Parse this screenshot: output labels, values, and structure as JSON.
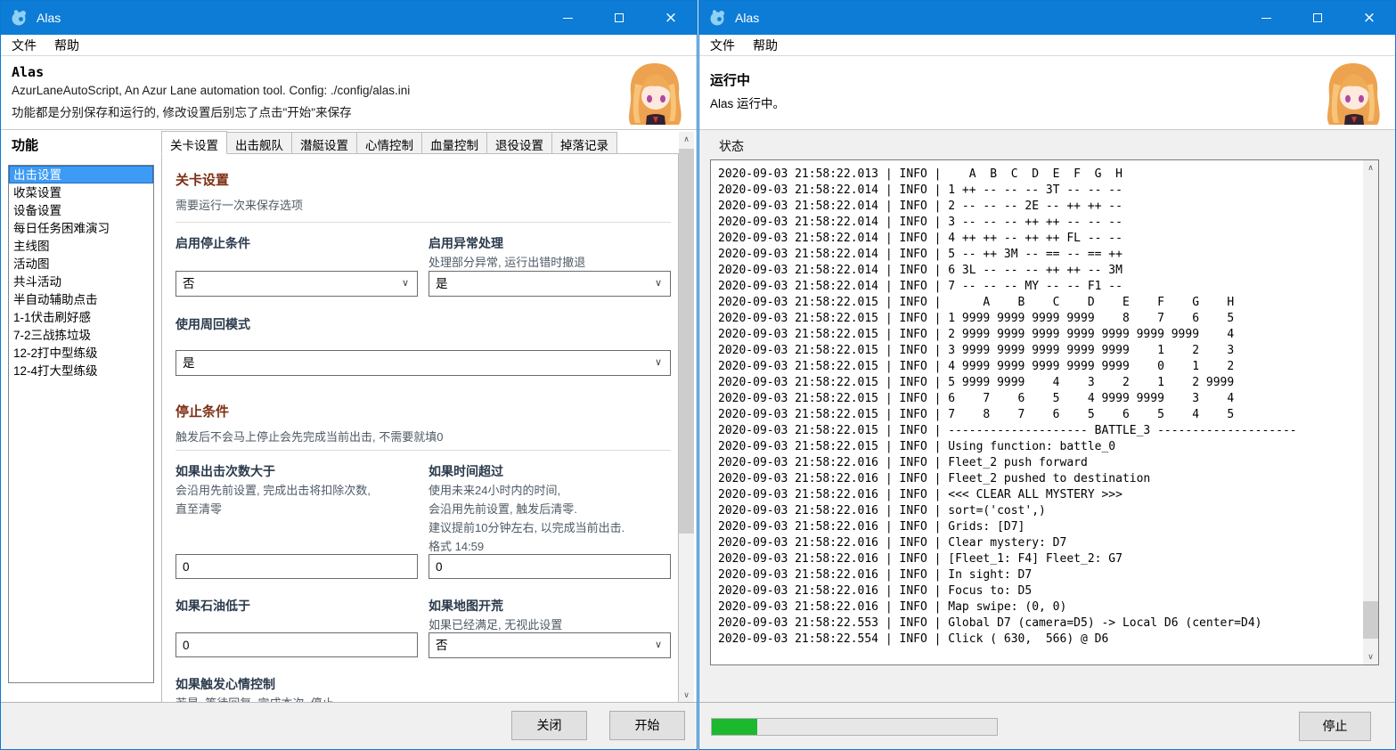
{
  "icons": {
    "close_glyph": "×",
    "chevron_down": "∨",
    "scroll_up": "∧",
    "scroll_down": "∨"
  },
  "colors": {
    "titlebar_blue": "#0c7cd6",
    "selection_blue": "#3d9bf5",
    "section_maroon": "#7e2f15",
    "progress_green": "#1cb82d"
  },
  "titlebar": {
    "title": "Alas"
  },
  "menubar": {
    "file": "文件",
    "help": "帮助"
  },
  "left": {
    "header": {
      "title": "Alas",
      "line1": "AzurLaneAutoScript, An Azur Lane automation tool. Config: ./config/alas.ini",
      "line2": "功能都是分别保存和运行的, 修改设置后别忘了点击\"开始\"来保存"
    },
    "sidebar": {
      "heading": "功能",
      "items": [
        {
          "label": "出击设置",
          "selected": true
        },
        {
          "label": "收菜设置",
          "selected": false
        },
        {
          "label": "设备设置",
          "selected": false
        },
        {
          "label": "每日任务困难演习",
          "selected": false
        },
        {
          "label": "主线图",
          "selected": false
        },
        {
          "label": "活动图",
          "selected": false
        },
        {
          "label": "共斗活动",
          "selected": false
        },
        {
          "label": "半自动辅助点击",
          "selected": false
        },
        {
          "label": "1-1伏击刷好感",
          "selected": false
        },
        {
          "label": "7-2三战拣垃圾",
          "selected": false
        },
        {
          "label": "12-2打中型练级",
          "selected": false
        },
        {
          "label": "12-4打大型练级",
          "selected": false
        }
      ]
    },
    "tabs": [
      {
        "label": "关卡设置",
        "active": true
      },
      {
        "label": "出击舰队",
        "active": false
      },
      {
        "label": "潜艇设置",
        "active": false
      },
      {
        "label": "心情控制",
        "active": false
      },
      {
        "label": "血量控制",
        "active": false
      },
      {
        "label": "退役设置",
        "active": false
      },
      {
        "label": "掉落记录",
        "active": false
      }
    ],
    "form": {
      "section1": {
        "title": "关卡设置",
        "subtitle": "需要运行一次来保存选项"
      },
      "enable_stop": {
        "label": "启用停止条件",
        "value": "否"
      },
      "enable_exception": {
        "label": "启用异常处理",
        "desc": "处理部分异常, 运行出错时撤退",
        "value": "是"
      },
      "loop_mode": {
        "label": "使用周回模式",
        "value": "是"
      },
      "section2": {
        "title": "停止条件",
        "subtitle": "触发后不会马上停止会先完成当前出击, 不需要就填0"
      },
      "if_count": {
        "label": "如果出击次数大于",
        "desc1": "会沿用先前设置, 完成出击将扣除次数,",
        "desc2": "直至清零",
        "value": "0"
      },
      "if_time": {
        "label": "如果时间超过",
        "desc1": "使用未来24小时内的时间,",
        "desc2": "会沿用先前设置, 触发后清零.",
        "desc3": "建议提前10分钟左右, 以完成当前出击.",
        "desc4": "格式 14:59",
        "value": "0"
      },
      "if_oil": {
        "label": "如果石油低于",
        "value": "0"
      },
      "if_map_clear": {
        "label": "如果地图开荒",
        "desc": "如果已经满足, 无视此设置",
        "value": "否"
      },
      "if_emotion": {
        "label": "如果触发心情控制",
        "desc": "若是, 等待回复, 完成本次, 停止"
      }
    },
    "footer": {
      "close": "关闭",
      "start": "开始"
    }
  },
  "right": {
    "header": {
      "title": "运行中",
      "line1": "Alas 运行中。"
    },
    "status_label": "状态",
    "log_lines": [
      "2020-09-03 21:58:22.013 | INFO |    A  B  C  D  E  F  G  H",
      "2020-09-03 21:58:22.014 | INFO | 1 ++ -- -- -- 3T -- -- --",
      "2020-09-03 21:58:22.014 | INFO | 2 -- -- -- 2E -- ++ ++ --",
      "2020-09-03 21:58:22.014 | INFO | 3 -- -- -- ++ ++ -- -- --",
      "2020-09-03 21:58:22.014 | INFO | 4 ++ ++ -- ++ ++ FL -- --",
      "2020-09-03 21:58:22.014 | INFO | 5 -- ++ 3M -- == -- == ++",
      "2020-09-03 21:58:22.014 | INFO | 6 3L -- -- -- ++ ++ -- 3M",
      "2020-09-03 21:58:22.014 | INFO | 7 -- -- -- MY -- -- F1 --",
      "2020-09-03 21:58:22.015 | INFO |      A    B    C    D    E    F    G    H",
      "2020-09-03 21:58:22.015 | INFO | 1 9999 9999 9999 9999    8    7    6    5",
      "2020-09-03 21:58:22.015 | INFO | 2 9999 9999 9999 9999 9999 9999 9999    4",
      "2020-09-03 21:58:22.015 | INFO | 3 9999 9999 9999 9999 9999    1    2    3",
      "2020-09-03 21:58:22.015 | INFO | 4 9999 9999 9999 9999 9999    0    1    2",
      "2020-09-03 21:58:22.015 | INFO | 5 9999 9999    4    3    2    1    2 9999",
      "2020-09-03 21:58:22.015 | INFO | 6    7    6    5    4 9999 9999    3    4",
      "2020-09-03 21:58:22.015 | INFO | 7    8    7    6    5    6    5    4    5",
      "2020-09-03 21:58:22.015 | INFO | -------------------- BATTLE_3 --------------------",
      "2020-09-03 21:58:22.015 | INFO | Using function: battle_0",
      "2020-09-03 21:58:22.016 | INFO | Fleet_2 push forward",
      "2020-09-03 21:58:22.016 | INFO | Fleet_2 pushed to destination",
      "2020-09-03 21:58:22.016 | INFO | <<< CLEAR ALL MYSTERY >>>",
      "2020-09-03 21:58:22.016 | INFO | sort=('cost',)",
      "2020-09-03 21:58:22.016 | INFO | Grids: [D7]",
      "2020-09-03 21:58:22.016 | INFO | Clear mystery: D7",
      "2020-09-03 21:58:22.016 | INFO | [Fleet_1: F4] Fleet_2: G7",
      "2020-09-03 21:58:22.016 | INFO | In sight: D7",
      "2020-09-03 21:58:22.016 | INFO | Focus to: D5",
      "2020-09-03 21:58:22.016 | INFO | Map swipe: (0, 0)",
      "2020-09-03 21:58:22.553 | INFO | Global D7 (camera=D5) -> Local D6 (center=D4)",
      "2020-09-03 21:58:22.554 | INFO | Click ( 630,  566) @ D6"
    ],
    "footer": {
      "stop": "停止",
      "progress_percent": 16
    }
  }
}
